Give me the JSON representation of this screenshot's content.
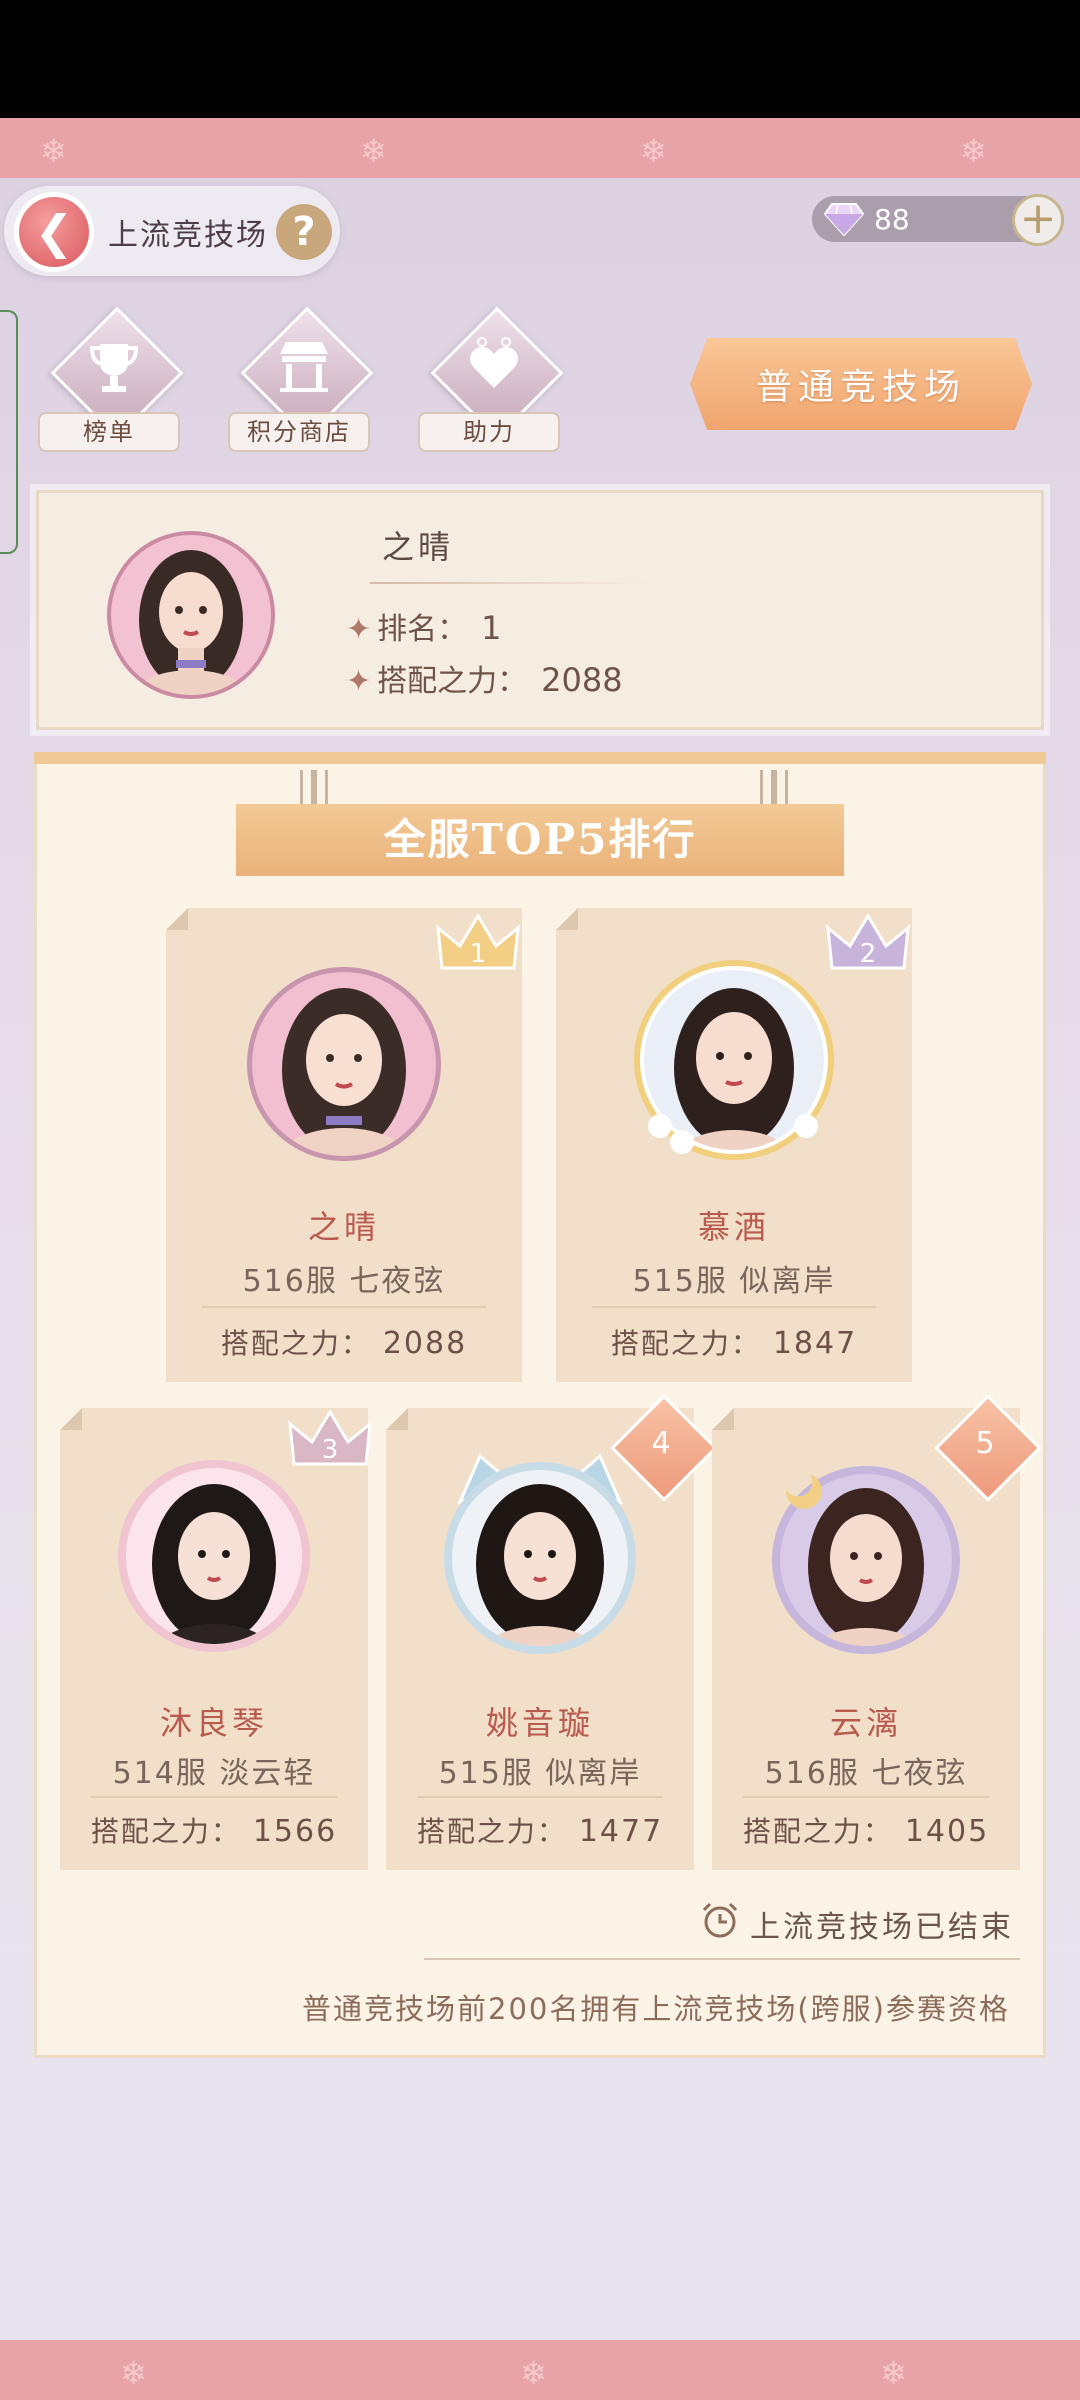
{
  "header": {
    "title": "上流竞技场",
    "help_label": "?",
    "gems": "88"
  },
  "menu": [
    {
      "label": "榜单",
      "icon": "trophy-icon"
    },
    {
      "label": "积分商店",
      "icon": "shop-icon"
    },
    {
      "label": "助力",
      "icon": "heart-icon"
    }
  ],
  "normal_arena_label": "普通竞技场",
  "profile": {
    "name": "之晴",
    "rank_label": "排名：",
    "rank_value": "1",
    "power_label": "搭配之力：",
    "power_value": "2088"
  },
  "board": {
    "title": "全服TOP5排行",
    "power_label": "搭配之力：",
    "entries": [
      {
        "rank": "1",
        "name": "之晴",
        "server": "516服 七夜弦",
        "power": "2088"
      },
      {
        "rank": "2",
        "name": "慕酒",
        "server": "515服 似离岸",
        "power": "1847"
      },
      {
        "rank": "3",
        "name": "沐良琴",
        "server": "514服 淡云轻",
        "power": "1566"
      },
      {
        "rank": "4",
        "name": "姚音璇",
        "server": "515服 似离岸",
        "power": "1477"
      },
      {
        "rank": "5",
        "name": "云漓",
        "server": "516服 七夜弦",
        "power": "1405"
      }
    ],
    "ended_text": "上流竞技场已结束",
    "qualify_text": "普通竞技场前200名拥有上流竞技场(跨服)参赛资格"
  },
  "colors": {
    "accent": "#f0a46e",
    "name_red": "#b85a4e",
    "card_bg": "#f1dfc9",
    "band": "#e8a3a8"
  }
}
